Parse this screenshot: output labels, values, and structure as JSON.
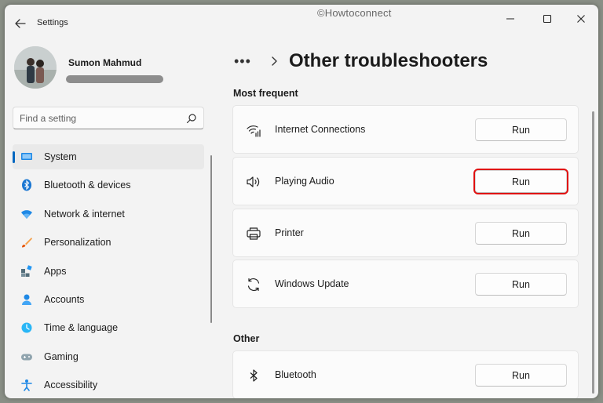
{
  "window": {
    "app_title": "Settings",
    "watermark": "©Howtoconnect"
  },
  "profile": {
    "name": "Sumon Mahmud"
  },
  "search": {
    "placeholder": "Find a setting"
  },
  "sidebar": {
    "items": [
      {
        "label": "System",
        "icon": "system-icon",
        "selected": true
      },
      {
        "label": "Bluetooth & devices",
        "icon": "bluetooth-icon"
      },
      {
        "label": "Network & internet",
        "icon": "wifi-icon"
      },
      {
        "label": "Personalization",
        "icon": "brush-icon"
      },
      {
        "label": "Apps",
        "icon": "apps-icon"
      },
      {
        "label": "Accounts",
        "icon": "person-icon"
      },
      {
        "label": "Time & language",
        "icon": "clock-globe-icon"
      },
      {
        "label": "Gaming",
        "icon": "gamepad-icon"
      },
      {
        "label": "Accessibility",
        "icon": "accessibility-icon"
      }
    ]
  },
  "header": {
    "more": "•••",
    "title": "Other troubleshooters"
  },
  "sections": {
    "most_frequent": {
      "title": "Most frequent",
      "items": [
        {
          "label": "Internet Connections",
          "button": "Run",
          "icon": "wifi-signal-icon"
        },
        {
          "label": "Playing Audio",
          "button": "Run",
          "icon": "speaker-icon",
          "highlighted": true
        },
        {
          "label": "Printer",
          "button": "Run",
          "icon": "printer-icon"
        },
        {
          "label": "Windows Update",
          "button": "Run",
          "icon": "sync-icon"
        }
      ]
    },
    "other": {
      "title": "Other",
      "items": [
        {
          "label": "Bluetooth",
          "button": "Run",
          "icon": "bluetooth-icon"
        }
      ]
    }
  },
  "colors": {
    "accent": "#0067c0",
    "highlight_border": "#e01010"
  }
}
